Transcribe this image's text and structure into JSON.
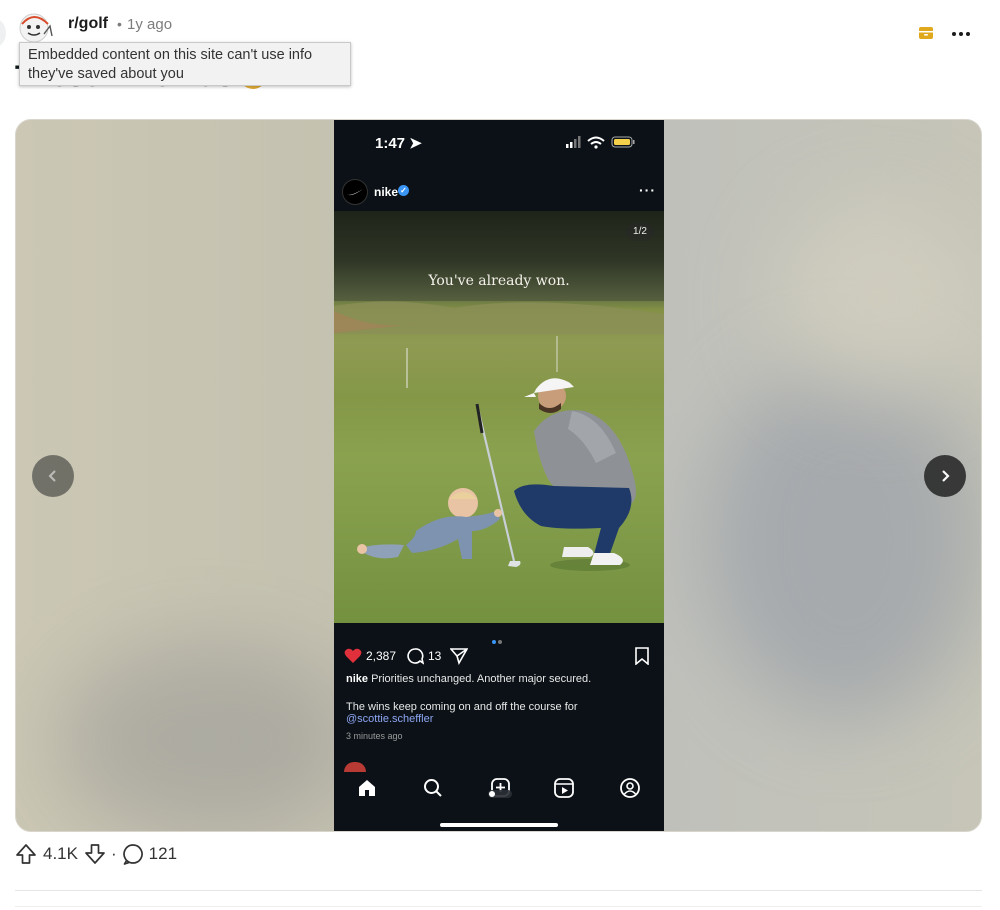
{
  "post": {
    "subreddit": "r/golf",
    "separator": "•",
    "time_ago": "1y ago",
    "author": "",
    "title": "These Nike Ads",
    "tooltip": "Embedded content on this site can't use info they've saved about you"
  },
  "media": {
    "prev_icon": "chevron-left-icon",
    "next_icon": "chevron-right-icon",
    "phone": {
      "status_time": "1:47",
      "account": "nike",
      "more": "···",
      "photo_counter": "1/2",
      "photo_caption": "You've already won.",
      "likes": "2,387",
      "comments": "13",
      "caption_user": "nike",
      "caption_text": "Priorities unchanged. Another major secured.",
      "caption_line2": "The wins keep coming on and off the course for",
      "mention": "@scottie.scheffler",
      "posted": "3 minutes ago",
      "tabs": [
        "home-icon",
        "search-icon",
        "create-icon",
        "reels-icon",
        "profile-icon"
      ]
    }
  },
  "footer": {
    "score": "4.1K",
    "separator": "·",
    "comments": "121"
  },
  "colors": {
    "heart": "#e0303c",
    "verified": "#3a95f5",
    "mention": "#8ea6f4",
    "battery": "#f5d04a"
  }
}
